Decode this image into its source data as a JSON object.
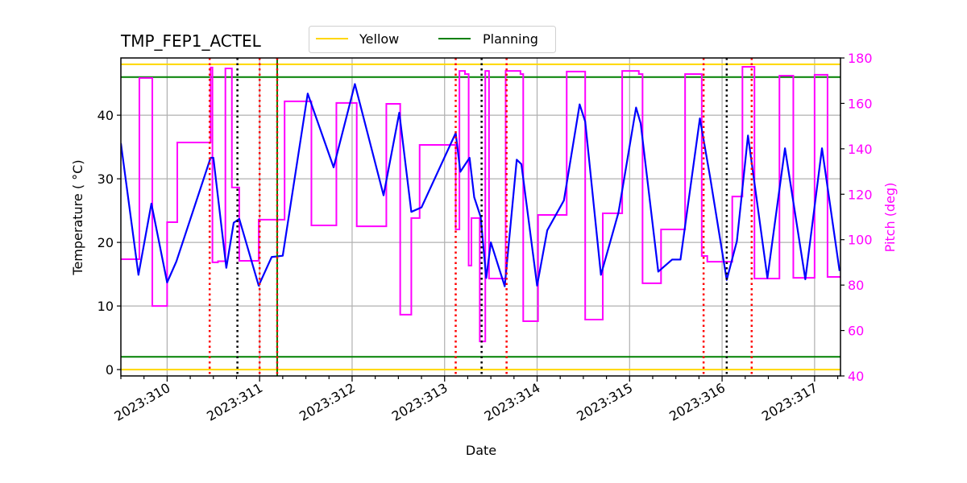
{
  "chart_data": {
    "type": "line",
    "title": "TMP_FEP1_ACTEL",
    "xlabel": "Date",
    "ylabel": "Temperature ($^\\circ$C)",
    "ylabel_display": "Temperature ( °C)",
    "ylabel_right": "Pitch (deg)",
    "xlim": [
      309.5,
      317.28
    ],
    "ylim": [
      -1,
      49
    ],
    "ylim_right": [
      40,
      180
    ],
    "grid": true,
    "legend_placement": "top-center, above plot",
    "x_ticks": [
      {
        "value": 310,
        "label": "2023:310"
      },
      {
        "value": 311,
        "label": "2023:311"
      },
      {
        "value": 312,
        "label": "2023:312"
      },
      {
        "value": 313,
        "label": "2023:313"
      },
      {
        "value": 314,
        "label": "2023:314"
      },
      {
        "value": 315,
        "label": "2023:315"
      },
      {
        "value": 316,
        "label": "2023:316"
      },
      {
        "value": 317,
        "label": "2023:317"
      }
    ],
    "x_minor_tick_step": 0.25,
    "y_ticks": [
      0,
      10,
      20,
      30,
      40
    ],
    "y_ticks_right": [
      40,
      60,
      80,
      100,
      120,
      140,
      160,
      180
    ],
    "colors": {
      "temperature": "#0000ff",
      "pitch": "#ff00ff",
      "yellow": "#ffd700",
      "planning": "#008000",
      "grid": "#b0b0b0",
      "event_red": "#ff0000",
      "event_black": "#000000"
    },
    "legend": [
      {
        "label": "Yellow",
        "color": "#ffd700"
      },
      {
        "label": "Planning",
        "color": "#008000"
      }
    ],
    "limits": [
      {
        "name": "yellow-high",
        "value": 48,
        "kind": "Yellow"
      },
      {
        "name": "planning-high",
        "value": 46,
        "kind": "Planning"
      },
      {
        "name": "planning-low",
        "value": 2,
        "kind": "Planning"
      },
      {
        "name": "yellow-low",
        "value": 0,
        "kind": "Yellow"
      }
    ],
    "event_lines": [
      {
        "x": 310.46,
        "style": "red-dotted"
      },
      {
        "x": 310.76,
        "style": "black-dotted"
      },
      {
        "x": 311.0,
        "style": "red-dotted"
      },
      {
        "x": 311.19,
        "style": "green-solid"
      },
      {
        "x": 311.19,
        "style": "red-dotted"
      },
      {
        "x": 313.12,
        "style": "red-dotted"
      },
      {
        "x": 313.4,
        "style": "black-dotted"
      },
      {
        "x": 313.67,
        "style": "red-dotted"
      },
      {
        "x": 315.8,
        "style": "red-dotted"
      },
      {
        "x": 316.05,
        "style": "black-dotted"
      },
      {
        "x": 316.32,
        "style": "red-dotted"
      }
    ],
    "series": [
      {
        "name": "Temperature",
        "axis": "left",
        "x": [
          309.5,
          309.69,
          309.83,
          310.0,
          310.1,
          310.47,
          310.5,
          310.64,
          310.72,
          310.78,
          310.99,
          311.13,
          311.25,
          311.52,
          311.8,
          312.03,
          312.34,
          312.51,
          312.64,
          312.75,
          313.12,
          313.17,
          313.27,
          313.32,
          313.39,
          313.45,
          313.5,
          313.65,
          313.78,
          313.83,
          314.0,
          314.11,
          314.29,
          314.46,
          314.52,
          314.69,
          314.88,
          315.07,
          315.12,
          315.31,
          315.46,
          315.55,
          315.76,
          315.87,
          316.05,
          316.16,
          316.28,
          316.49,
          316.68,
          316.9,
          317.08,
          317.27
        ],
        "y": [
          35.6,
          14.9,
          26.1,
          13.7,
          17.0,
          33.3,
          33.3,
          16.0,
          23.1,
          23.7,
          13.2,
          17.7,
          17.9,
          43.4,
          31.8,
          44.9,
          27.4,
          40.4,
          24.8,
          25.5,
          37.2,
          31.1,
          33.3,
          27.1,
          24.0,
          14.4,
          20.0,
          13.1,
          33.0,
          32.3,
          13.2,
          21.9,
          26.6,
          41.7,
          39.0,
          14.9,
          24.7,
          41.2,
          38.7,
          15.4,
          17.3,
          17.3,
          39.5,
          30.3,
          14.1,
          20.2,
          36.8,
          14.4,
          34.8,
          14.2,
          34.8,
          15.5
        ]
      },
      {
        "name": "Pitch",
        "axis": "right",
        "steps": [
          [
            309.5,
            91.4
          ],
          [
            309.7,
            171.2
          ],
          [
            309.84,
            70.8
          ],
          [
            310.0,
            107.7
          ],
          [
            310.11,
            142.8
          ],
          [
            310.47,
            175.8
          ],
          [
            310.49,
            90.0
          ],
          [
            310.55,
            90.5
          ],
          [
            310.63,
            175.4
          ],
          [
            310.7,
            123.0
          ],
          [
            310.75,
            123.0
          ],
          [
            310.78,
            90.7
          ],
          [
            310.99,
            108.8
          ],
          [
            311.25,
            108.8
          ],
          [
            311.27,
            160.9
          ],
          [
            311.56,
            106.3
          ],
          [
            311.83,
            160.2
          ],
          [
            312.05,
            105.9
          ],
          [
            312.37,
            159.8
          ],
          [
            312.52,
            67.0
          ],
          [
            312.64,
            109.5
          ],
          [
            312.73,
            141.7
          ],
          [
            313.12,
            104.5
          ],
          [
            313.16,
            174.3
          ],
          [
            313.22,
            172.9
          ],
          [
            313.26,
            88.6
          ],
          [
            313.29,
            109.5
          ],
          [
            313.38,
            55.2
          ],
          [
            313.44,
            174.3
          ],
          [
            313.48,
            82.9
          ],
          [
            313.66,
            174.3
          ],
          [
            313.82,
            172.9
          ],
          [
            313.85,
            64.1
          ],
          [
            314.01,
            110.9
          ],
          [
            314.32,
            174.0
          ],
          [
            314.52,
            64.8
          ],
          [
            314.71,
            111.6
          ],
          [
            314.92,
            174.3
          ],
          [
            315.1,
            172.9
          ],
          [
            315.14,
            80.8
          ],
          [
            315.34,
            104.5
          ],
          [
            315.6,
            172.9
          ],
          [
            315.78,
            92.8
          ],
          [
            315.84,
            90.3
          ],
          [
            316.11,
            119.0
          ],
          [
            316.22,
            176.1
          ],
          [
            316.35,
            82.9
          ],
          [
            316.62,
            172.2
          ],
          [
            316.77,
            83.2
          ],
          [
            317.0,
            172.6
          ],
          [
            317.14,
            83.6
          ],
          [
            317.28,
            83.6
          ]
        ]
      }
    ]
  }
}
